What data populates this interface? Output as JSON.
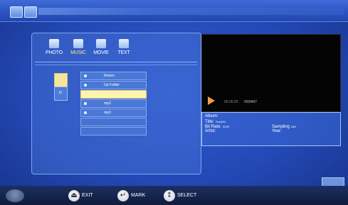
{
  "categories": [
    {
      "label": "PHOTO",
      "icon": "photo-icon",
      "active": false
    },
    {
      "label": "MUSIC",
      "icon": "music-icon",
      "active": true
    },
    {
      "label": "MOVIE",
      "icon": "movie-icon",
      "active": false
    },
    {
      "label": "TEXT",
      "icon": "text-icon",
      "active": false
    }
  ],
  "devices": {
    "selected_label": "D:"
  },
  "file_list": {
    "rows": [
      {
        "name": "Return"
      },
      {
        "name": "Up Folder"
      },
      {
        "name": ""
      },
      {
        "name": "mp3"
      },
      {
        "name": "mp3"
      }
    ]
  },
  "player": {
    "current_time": "00:00:20",
    "total_time": "/000407"
  },
  "info": {
    "album_label": "Album:",
    "title_label": "Title:",
    "title_value": "Track01",
    "bitrate_label": "Bit Rate:",
    "bitrate_value": "320K",
    "artist_label": "Artist:",
    "sampling_label": "Sampling",
    "sampling_value": "44K",
    "year_label": "Year:"
  },
  "footer": {
    "exit_label": "EXIT",
    "mark_label": "MARK",
    "select_label": "SELECT"
  },
  "colors": {
    "accent_highlight": "#fff3b0",
    "active_category": "#ffe680",
    "play_icon": "#f0a040"
  }
}
